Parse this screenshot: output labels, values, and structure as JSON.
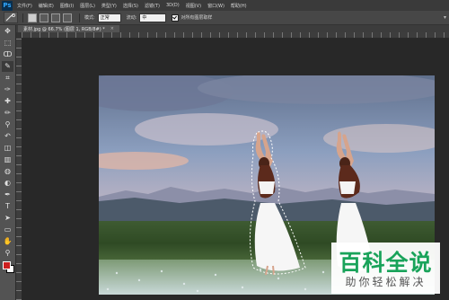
{
  "app": {
    "logo": "Ps"
  },
  "menu": [
    "文件(F)",
    "编辑(E)",
    "图像(I)",
    "图层(L)",
    "类型(Y)",
    "选择(S)",
    "滤镜(T)",
    "3D(D)",
    "视图(V)",
    "窗口(W)",
    "帮助(H)"
  ],
  "options": {
    "tool_preset": "quick-selection-icon",
    "mode_icons": [
      "new-selection-icon",
      "add-selection-icon",
      "subtract-selection-icon",
      "intersect-selection-icon"
    ],
    "style_label": "模式:",
    "style_value": "正常",
    "feather_label": "流动:",
    "feather_value": "中",
    "sample_all_layers": "对所有图层取样",
    "right_icon": "workspace-icon"
  },
  "document_tab": {
    "title": "素材.jpg @ 66.7% (图层 1, RGB/8#) *",
    "close": "×"
  },
  "tools": [
    "move-icon",
    "marquee-icon",
    "lasso-icon",
    "quick-selection-icon",
    "crop-icon",
    "eyedropper-icon",
    "healing-icon",
    "brush-icon",
    "clone-stamp-icon",
    "history-brush-icon",
    "eraser-icon",
    "gradient-icon",
    "blur-icon",
    "dodge-icon",
    "pen-icon",
    "type-icon",
    "path-selection-icon",
    "shape-icon",
    "hand-icon",
    "zoom-icon"
  ],
  "tool_glyphs": [
    "✥",
    "⬚",
    "ↀ",
    "✎",
    "⌗",
    "✑",
    "✚",
    "✏",
    "⚲",
    "↶",
    "◫",
    "▥",
    "◍",
    "◐",
    "✒",
    "T",
    "➤",
    "▭",
    "✋",
    "⚲"
  ],
  "colors": {
    "foreground": "#cc1f1f",
    "background": "#ffffff",
    "accent": "#31a8ff"
  },
  "watermark": {
    "main": "百科全说",
    "sub": "助你轻松解决"
  }
}
